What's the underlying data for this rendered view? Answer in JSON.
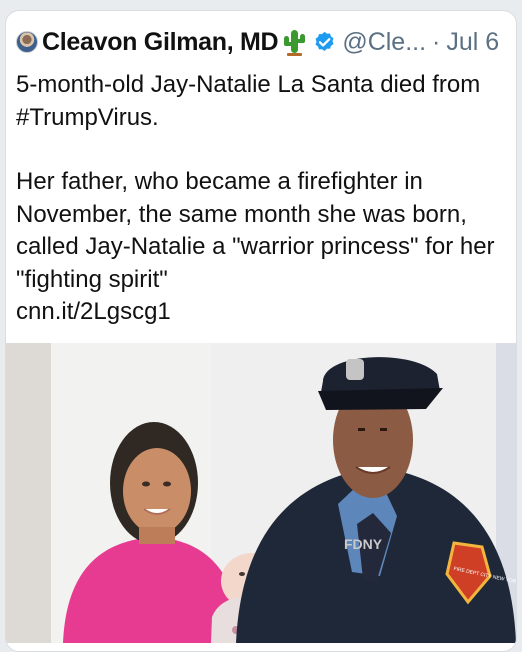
{
  "tweet": {
    "display_name": "Cleavon Gilman, MD",
    "handle": "@Cle...",
    "separator": "·",
    "timestamp": "Jul 6",
    "line1": "5-month-old Jay-Natalie La Santa died from",
    "hashtag": "#TrumpVirus.",
    "para2": "Her father, who became a firefighter in November, the same month she was born, called Jay-Natalie a \"warrior princess\" for her \"fighting spirit\"",
    "link": "cnn.it/2Lgscg1"
  },
  "media": {
    "jacket_text": "FDNY",
    "patch_text": "FIRE DEPT CITY NEW YORK"
  },
  "colors": {
    "text": "#111111",
    "secondary": "#5b7083",
    "verified": "#1d9bf0",
    "cactus": "#3a9a2f"
  },
  "icons": [
    "avatar",
    "cactus-icon",
    "verified-icon"
  ]
}
